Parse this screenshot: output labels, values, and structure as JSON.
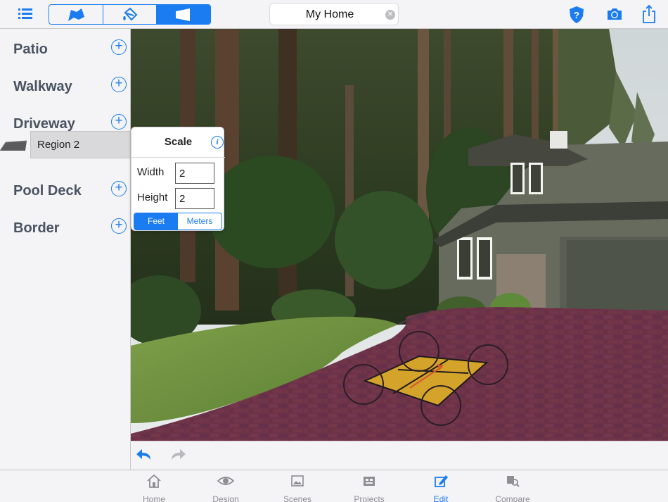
{
  "toolbar": {
    "menu_icon": "list-icon",
    "segments": [
      {
        "icon": "region-shape-icon",
        "active": false
      },
      {
        "icon": "paint-bucket-icon",
        "active": false
      },
      {
        "icon": "perspective-plane-icon",
        "active": true
      }
    ],
    "project_name": "My Home",
    "clear_icon": "clear-circle-icon",
    "help_icon": "help-shield-icon",
    "camera_icon": "camera-icon",
    "share_icon": "share-icon",
    "accent_color": "#1a7cf0"
  },
  "sidebar": {
    "categories": [
      {
        "label": "Patio",
        "plus": "+"
      },
      {
        "label": "Walkway",
        "plus": "+"
      },
      {
        "label": "Driveway",
        "plus": "+"
      },
      {
        "label": "Pool Deck",
        "plus": "+"
      },
      {
        "label": "Border",
        "plus": "+"
      }
    ],
    "selected_region": {
      "label": "Region 2",
      "parent": "Driveway"
    }
  },
  "scale_popup": {
    "title": "Scale",
    "info": "i",
    "width_label": "Width",
    "width_value": "2",
    "height_label": "Height",
    "height_value": "2",
    "units": [
      "Feet",
      "Meters"
    ],
    "selected_unit": "Feet"
  },
  "edit_bar": {
    "undo_icon": "undo-icon",
    "redo_icon": "redo-icon"
  },
  "tabs": [
    {
      "label": "Home",
      "icon": "home-icon",
      "active": false
    },
    {
      "label": "Design",
      "icon": "eye-icon",
      "active": false
    },
    {
      "label": "Scenes",
      "icon": "image-icon",
      "active": false
    },
    {
      "label": "Projects",
      "icon": "projects-icon",
      "active": false
    },
    {
      "label": "Edit",
      "icon": "pencil-edit-icon",
      "active": true
    },
    {
      "label": "Compare",
      "icon": "compare-icon",
      "active": false
    }
  ]
}
